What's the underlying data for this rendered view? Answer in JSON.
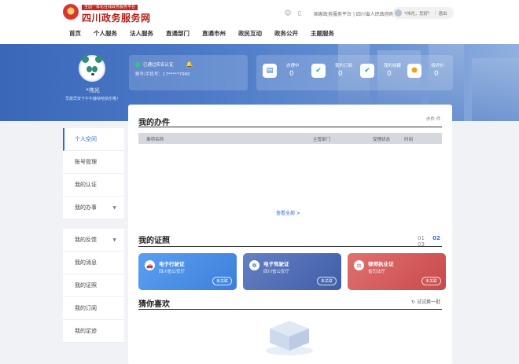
{
  "header": {
    "logo_sub": "全国一体化在线政务服务平台",
    "logo_title": "四川政务服务网",
    "top_icons": [
      "wechat-icon",
      "mobile-icon"
    ],
    "top_link_1": "国家政务服务平台",
    "top_link_sep": "|",
    "top_link_2": "四川省人民政府网",
    "user_name": "*伟光，您好！",
    "user_sep": "|",
    "logout": "退出"
  },
  "nav": [
    "首页",
    "个人服务",
    "法人服务",
    "直通部门",
    "直通市州",
    "政民互动",
    "政务公开",
    "主题服务"
  ],
  "profile": {
    "name": "*伟光",
    "greeting": "早晨早安下午午静快哈快乐哦！",
    "auth_status": "已通过实名认证",
    "account_label": "账号/手机号：17*****7980"
  },
  "stats": [
    {
      "label": "办理中",
      "value": "0",
      "icon": "doc-icon",
      "color": "#2c6ad8"
    },
    {
      "label": "我的订阅",
      "value": "0",
      "icon": "check-icon",
      "color": "#1aa3c8"
    },
    {
      "label": "我的收藏",
      "value": "0",
      "icon": "star-box-icon",
      "color": "#1aa3c8"
    },
    {
      "label": "待评价",
      "value": "0",
      "icon": "shield-icon",
      "color": "#f0a020"
    }
  ],
  "sidebar": {
    "group1": [
      "个人空间",
      "账号管理",
      "我的认证",
      "我的办事"
    ],
    "group2": [
      "我的反馈",
      "我的消息",
      "我的证照",
      "我的订阅",
      "我的足迹"
    ]
  },
  "work": {
    "title": "我的办件",
    "right": "办件 件",
    "cols": [
      "事项名称",
      "主管部门",
      "受理状态",
      "时间"
    ],
    "view_all": "查看全部 >"
  },
  "licenses": {
    "title": "我的证照",
    "pages": [
      "01",
      "02",
      "03"
    ],
    "cards": [
      {
        "name": "电子行驶证",
        "org": "四川省公安厅",
        "btn": "未关联",
        "color": "#4a90e8",
        "icon": "car-icon"
      },
      {
        "name": "电子驾驶证",
        "org": "四川省公安厅",
        "btn": "未关联",
        "color": "#4f6fb6",
        "icon": "wheel-icon"
      },
      {
        "name": "律师执业证",
        "org": "省司法厅",
        "btn": "未关联",
        "color": "#d45a5a",
        "icon": "scale-icon"
      }
    ]
  },
  "guess": {
    "title": "猜你喜欢",
    "refresh": "试试换一批"
  }
}
